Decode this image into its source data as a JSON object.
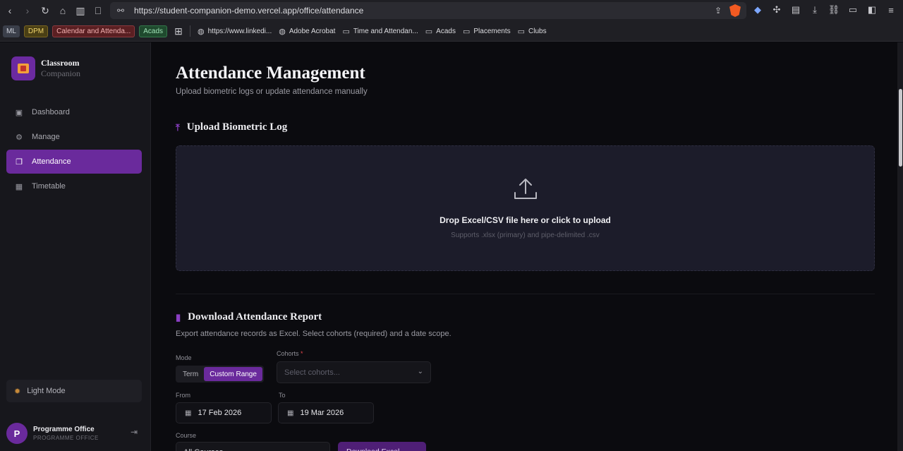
{
  "browser": {
    "url": "https://student-companion-demo.vercel.app/office/attendance",
    "bookmarks": {
      "chips": [
        "ML",
        "DPM",
        "Calendar and Attenda...",
        "Acads"
      ],
      "links": [
        "https://www.linkedi...",
        "Adobe Acrobat",
        "Time and Attendan...",
        "Acads",
        "Placements",
        "Clubs"
      ]
    }
  },
  "sidebar": {
    "brand_title": "Classroom",
    "brand_sub": "Companion",
    "items": [
      {
        "label": "Dashboard",
        "icon": "dashboard-icon"
      },
      {
        "label": "Manage",
        "icon": "gear-icon"
      },
      {
        "label": "Attendance",
        "icon": "clipboard-icon",
        "active": true
      },
      {
        "label": "Timetable",
        "icon": "calendar-icon"
      }
    ],
    "light_mode": "Light Mode",
    "user": {
      "initial": "P",
      "name": "Programme Office",
      "role": "PROGRAMME OFFICE"
    }
  },
  "main": {
    "title": "Attendance Management",
    "subtitle": "Upload biometric logs or update attendance manually",
    "upload": {
      "heading": "Upload Biometric Log",
      "drop_text": "Drop Excel/CSV file here or click to upload",
      "drop_hint": "Supports .xlsx (primary) and pipe-delimited .csv"
    },
    "report": {
      "heading": "Download Attendance Report",
      "subtitle": "Export attendance records as Excel. Select cohorts (required) and a date scope.",
      "mode_label": "Mode",
      "modes": [
        "Term",
        "Custom Range"
      ],
      "active_mode": "Custom Range",
      "cohorts_label": "Cohorts",
      "cohorts_required": "*",
      "cohorts_placeholder": "Select cohorts...",
      "from_label": "From",
      "from_value": "17 Feb 2026",
      "to_label": "To",
      "to_value": "19 Mar 2026",
      "course_label": "Course",
      "course_value": "All Courses",
      "download_label": "Download Excel"
    }
  },
  "colors": {
    "accent": "#6a2a9c",
    "background": "#0b0b0f",
    "sidebar": "#17171c",
    "dropzone": "#1c1c2a"
  }
}
